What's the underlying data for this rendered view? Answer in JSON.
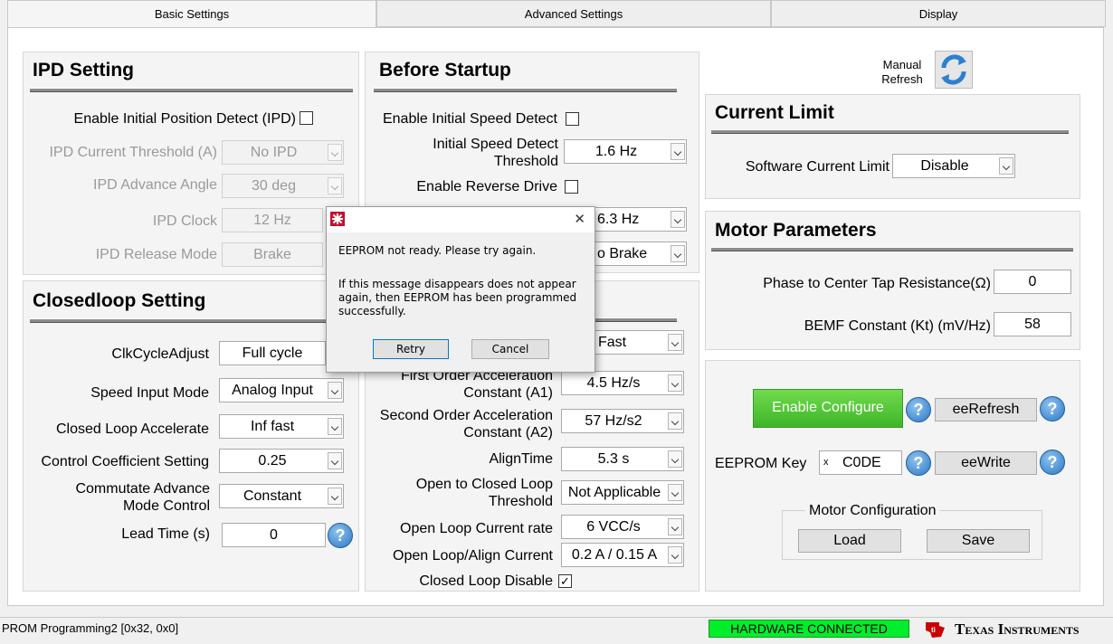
{
  "tabs": [
    "Basic Settings",
    "Advanced Settings",
    "Display"
  ],
  "ipd": {
    "title": "IPD Setting",
    "enable_label": "Enable Initial Position Detect (IPD)",
    "current_threshold_label": "IPD Current Threshold (A)",
    "current_threshold_value": "No IPD",
    "advance_angle_label": "IPD Advance Angle",
    "advance_angle_value": "30 deg",
    "clock_label": "IPD Clock",
    "clock_value": "12 Hz",
    "release_mode_label": "IPD Release Mode",
    "release_mode_value": "Brake"
  },
  "before_startup": {
    "title": "Before Startup",
    "isd_label": "Enable Initial Speed Detect",
    "isd_threshold_label": "Initial Speed Detect Threshold",
    "isd_threshold_value": "1.6 Hz",
    "reverse_label": "Enable Reverse Drive",
    "hidden_row_value": "6.3 Hz",
    "brake_value": "o Brake"
  },
  "closedloop": {
    "title": "Closedloop Setting",
    "clk_label": "ClkCycleAdjust",
    "clk_value": "Full cycle",
    "speed_input_label": "Speed Input Mode",
    "speed_input_value": "Analog Input",
    "accel_label": "Closed Loop Accelerate",
    "accel_value": "Inf fast",
    "coeff_label": "Control Coefficient Setting",
    "coeff_value": "0.25",
    "commutate_label": "Commutate Advance Mode Control",
    "commutate_value": "Constant",
    "lead_label": "Lead Time (s)",
    "lead_value": "0"
  },
  "startup": {
    "fast_value": "Fast",
    "a1_label": "First Order Acceleration Constant (A1)",
    "a1_value": "4.5 Hz/s",
    "a2_label": "Second Order Acceleration Constant (A2)",
    "a2_value": "57 Hz/s2",
    "align_label": "AlignTime",
    "align_value": "5.3 s",
    "threshold_label": "Open to Closed Loop Threshold",
    "threshold_value": "Not Applicable",
    "rate_label": "Open Loop Current rate",
    "rate_value": "6 VCC/s",
    "align_current_label": "Open Loop/Align Current",
    "align_current_value": "0.2 A / 0.15 A",
    "cl_disable_label": "Closed Loop Disable",
    "cl_disable_mark": "✓"
  },
  "manual_refresh": "Manual Refresh",
  "current_limit": {
    "title": "Current Limit",
    "label": "Software Current Limit",
    "value": "Disable"
  },
  "motor": {
    "title": "Motor Parameters",
    "resistance_label": "Phase to Center Tap Resistance(Ω)",
    "resistance_value": "0",
    "bemf_label": "BEMF Constant (Kt) (mV/Hz)",
    "bemf_value": "58"
  },
  "config": {
    "enable_label": "Enable Configure",
    "ee_refresh": "eeRefresh",
    "key_label": "EEPROM Key",
    "key_prefix": "x",
    "key_value": "C0DE",
    "ee_write": "eeWrite",
    "group_title": "Motor Configuration",
    "load": "Load",
    "save": "Save"
  },
  "dialog": {
    "message1": "EEPROM not ready. Please try again.",
    "message2": "If this message disappears does not appear again, then EEPROM has been programmed successfully.",
    "retry": "Retry",
    "cancel": "Cancel",
    "close_glyph": "✕"
  },
  "status": {
    "left": "PROM Programming2 [0x32, 0x0]",
    "connection": "HARDWARE CONNECTED",
    "brand": "Texas Instruments"
  },
  "help_glyph": "?",
  "colors": {
    "accent_green": "#00ee2b",
    "ti_red": "#cc0000",
    "help_blue": "#2b78c4"
  }
}
